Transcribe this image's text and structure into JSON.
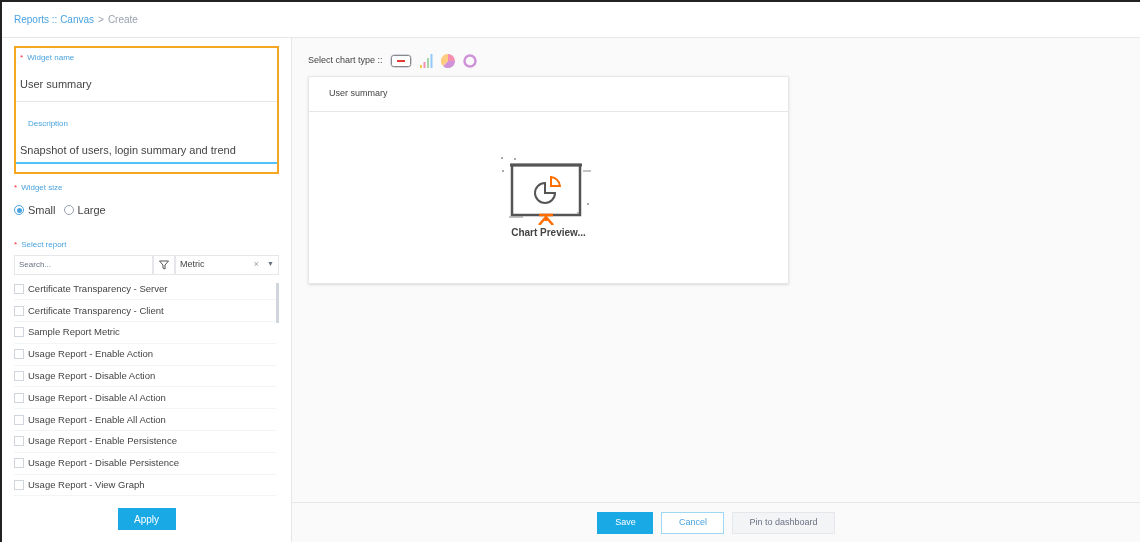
{
  "breadcrumb": {
    "links": [
      "Reports :: Canvas"
    ],
    "separator": ">",
    "current": "Create"
  },
  "form": {
    "name_field": {
      "label": "Widget name",
      "required_mark": "*",
      "value": "User summary"
    },
    "description_field": {
      "label": "Description",
      "value": "Snapshot of users, login summary and trend"
    },
    "size": {
      "label": "Widget size",
      "required_mark": "*",
      "options": [
        {
          "label": "Small",
          "selected": true
        },
        {
          "label": "Large",
          "selected": false
        }
      ]
    },
    "report": {
      "label": "Select report",
      "required_mark": "*",
      "search_placeholder": "Search...",
      "filter_value": "Metric",
      "clear": "×",
      "caret": "▼",
      "items": [
        {
          "label": "Certificate Transparency - Server",
          "checked": false
        },
        {
          "label": "Certificate Transparency - Client",
          "checked": false
        },
        {
          "label": "Sample Report Metric",
          "checked": false
        },
        {
          "label": "Usage Report - Enable Action",
          "checked": false
        },
        {
          "label": "Usage Report - Disable Action",
          "checked": false
        },
        {
          "label": "Usage Report - Disable Al Action",
          "checked": false
        },
        {
          "label": "Usage Report - Enable All Action",
          "checked": false
        },
        {
          "label": "Usage Report - Enable Persistence",
          "checked": false
        },
        {
          "label": "Usage Report - Disable Persistence",
          "checked": false
        },
        {
          "label": "Usage Report - View Graph",
          "checked": false
        }
      ]
    },
    "apply": "Apply"
  },
  "chart_type": {
    "label": "Select chart type ::",
    "types": [
      {
        "kind": "number",
        "selected": true
      },
      {
        "kind": "bar",
        "selected": false
      },
      {
        "kind": "pie",
        "selected": false
      },
      {
        "kind": "donut",
        "selected": false
      }
    ]
  },
  "preview": {
    "title": "User summary",
    "caption": "Chart Preview..."
  },
  "buttons": [
    {
      "label": "Save",
      "kind": "primary"
    },
    {
      "label": "Cancel",
      "kind": "secondary"
    },
    {
      "label": "Pin to dashboard",
      "kind": "disabled"
    }
  ]
}
